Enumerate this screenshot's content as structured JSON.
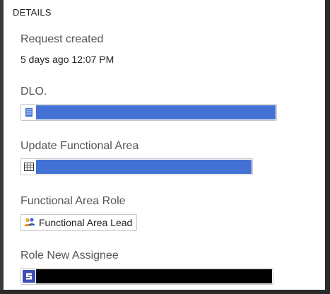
{
  "details": {
    "header": "DETAILS",
    "request_created": {
      "label": "Request created",
      "value": "5 days ago 12:07 PM"
    },
    "dlo": {
      "label": "DLO."
    },
    "update_functional_area": {
      "label": "Update Functional Area"
    },
    "functional_area_role": {
      "label": "Functional Area Role",
      "value": "Functional Area Lead"
    },
    "role_new_assignee": {
      "label": "Role New Assignee"
    }
  },
  "colors": {
    "redaction_blue": "#4472d4",
    "redaction_black": "#000000",
    "assignee_icon_blue": "#3d4fb5"
  }
}
